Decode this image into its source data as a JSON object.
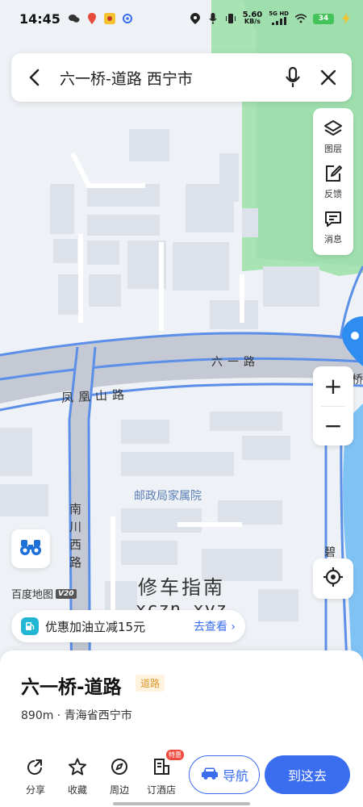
{
  "status_bar": {
    "time": "14:45",
    "net_speed_top": "5.60",
    "net_speed_bottom": "KB/s",
    "net_type": "5G HD",
    "battery": "34"
  },
  "search": {
    "query": "六一桥-道路 西宁市"
  },
  "tools": {
    "layers_label": "图层",
    "feedback_label": "反馈",
    "messages_label": "消息"
  },
  "zoom": {
    "in": "+",
    "out": "−"
  },
  "map_labels": {
    "road_liuyi": "六一路",
    "road_fenghuangshan": "凤凰山路",
    "road_nanchuan_west": [
      "南",
      "川",
      "西",
      "路"
    ],
    "poi_postal": "邮政局家属院",
    "edge_qiao": "桥",
    "edge_bi": "碧"
  },
  "map_logo": {
    "text": "百度地图",
    "version": "V20"
  },
  "watermark": {
    "line1": "修车指南",
    "line2": "xczn.xyz"
  },
  "promo": {
    "text": "优惠加油立减15元",
    "link": "去查看 ›"
  },
  "place": {
    "name": "六一桥-道路",
    "tag": "道路",
    "subtitle": "890m · 青海省西宁市"
  },
  "actions": {
    "share": "分享",
    "favorite": "收藏",
    "nearby": "周边",
    "hotel": "订酒店",
    "hotel_badge": "特惠",
    "navigate": "导航",
    "go_here": "到这去"
  },
  "colors": {
    "accent": "#3a6df0",
    "road_blue": "#5b8fe8",
    "park_green": "#a6e3b2",
    "water_blue": "#7fc3f5"
  }
}
